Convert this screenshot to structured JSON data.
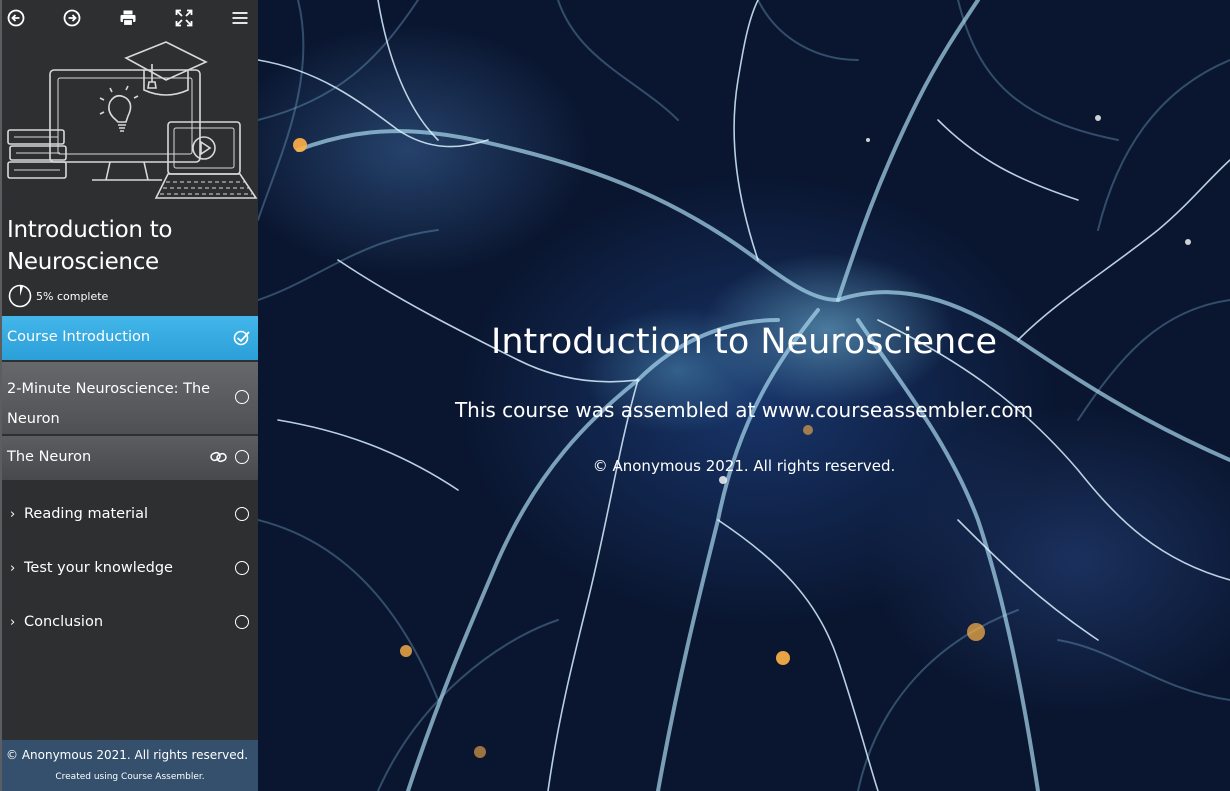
{
  "toolbar": {
    "icons": [
      "previous-icon",
      "next-icon",
      "print-icon",
      "fullscreen-icon",
      "menu-icon"
    ]
  },
  "course": {
    "title": "Introduction to Neuroscience",
    "progress_label": "5% complete",
    "progress_percent": 5
  },
  "nav": {
    "items": [
      {
        "label": "Course Introduction",
        "status": "completed",
        "active": true
      },
      {
        "label": "2-Minute Neuroscience: The Neuron",
        "status": "incomplete"
      },
      {
        "label": "The Neuron",
        "status": "incomplete",
        "has_link_icon": true
      },
      {
        "label": "Reading material",
        "status": "incomplete",
        "expandable": true
      },
      {
        "label": "Test your knowledge",
        "status": "incomplete",
        "expandable": true
      },
      {
        "label": "Conclusion",
        "status": "incomplete",
        "expandable": true
      }
    ]
  },
  "footer": {
    "copyright": "© Anonymous 2021. All rights reserved.",
    "created": "Created using Course Assembler."
  },
  "main": {
    "title": "Introduction to Neuroscience",
    "subtitle": "This course was assembled at www.courseassembler.com",
    "copyright": "© Anonymous 2021. All rights reserved."
  },
  "colors": {
    "sidebar_bg": "#2e2f31",
    "active_item": "#2b9fd8",
    "footer_bg": "#34506c",
    "main_bg": "#0a1630"
  }
}
